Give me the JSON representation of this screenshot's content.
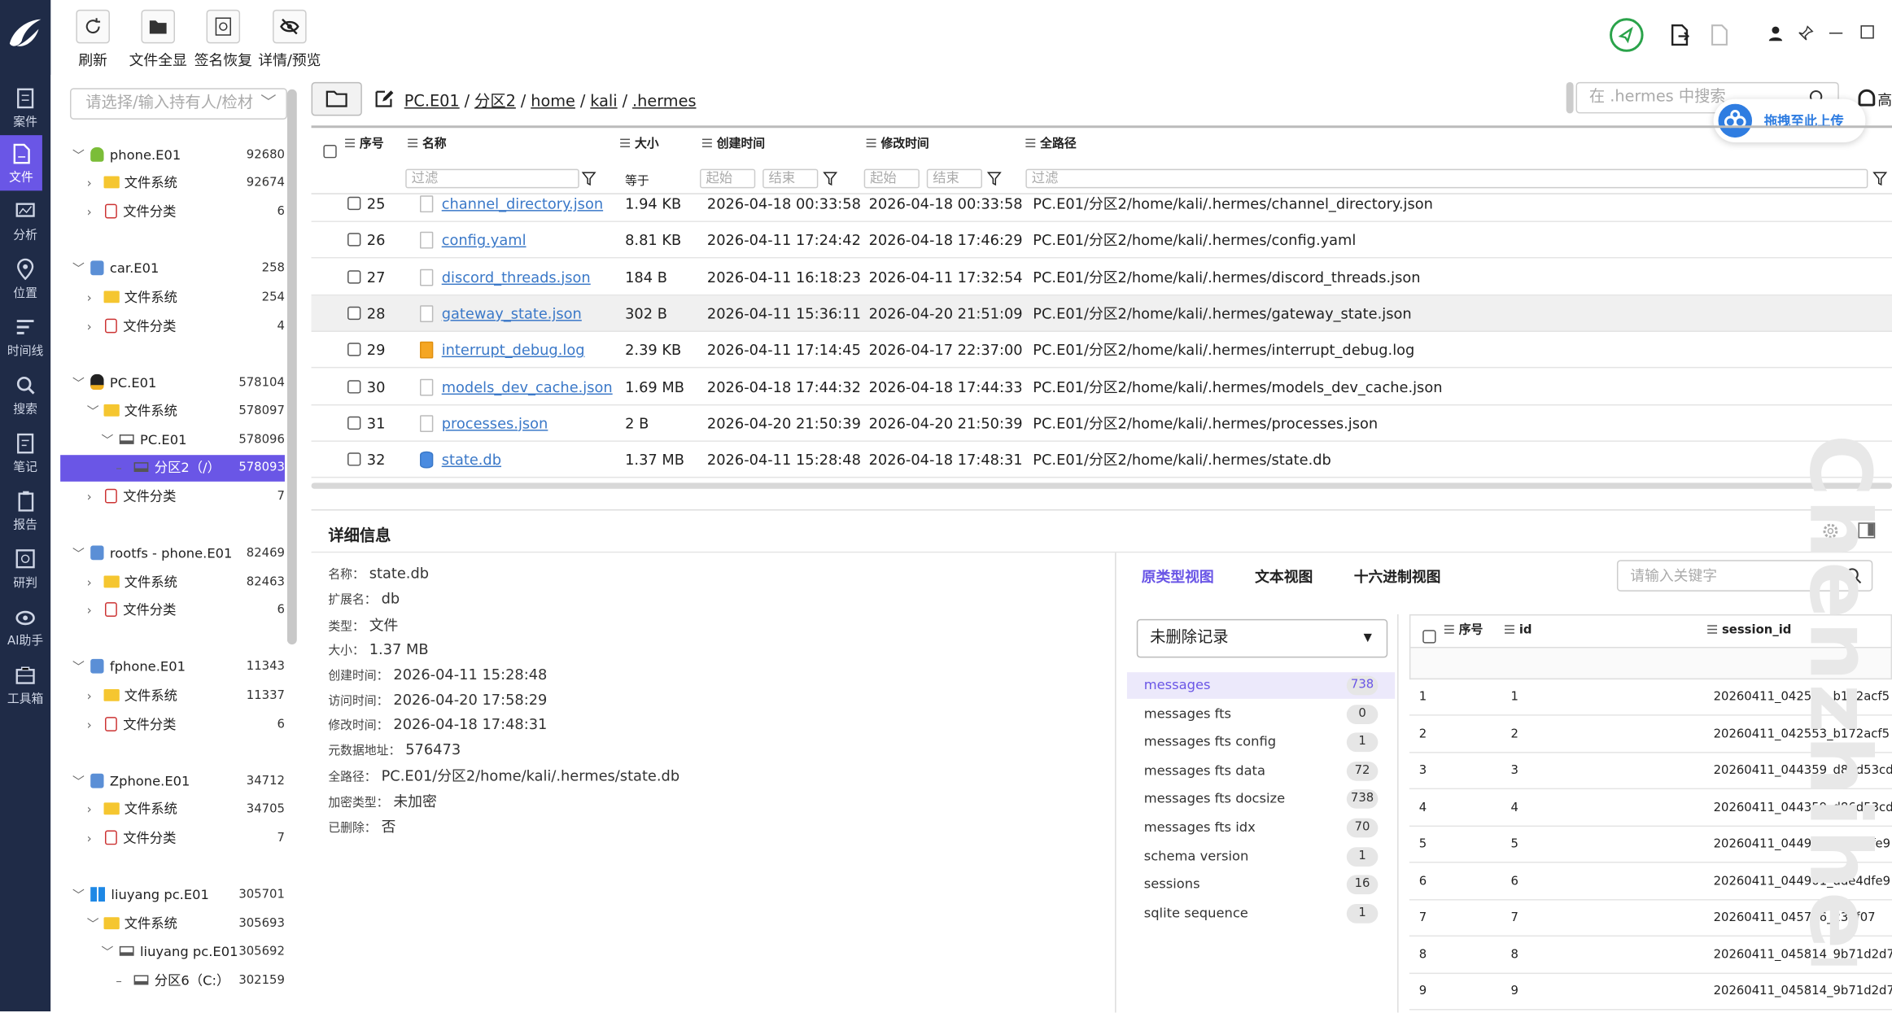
{
  "nav": {
    "items": [
      {
        "label": "案件",
        "icon": "case-icon"
      },
      {
        "label": "文件",
        "icon": "file-icon"
      },
      {
        "label": "分析",
        "icon": "analysis-icon"
      },
      {
        "label": "位置",
        "icon": "location-icon"
      },
      {
        "label": "时间线",
        "icon": "timeline-icon"
      },
      {
        "label": "搜索",
        "icon": "search-icon"
      },
      {
        "label": "笔记",
        "icon": "note-icon"
      },
      {
        "label": "报告",
        "icon": "report-icon"
      },
      {
        "label": "研判",
        "icon": "judge-icon"
      },
      {
        "label": "AI助手",
        "icon": "ai-icon"
      },
      {
        "label": "工具箱",
        "icon": "toolbox-icon"
      }
    ]
  },
  "toolbar": {
    "refresh": "刷新",
    "show_all": "文件全显",
    "sig_restore": "签名恢复",
    "detail_preview": "详情/预览"
  },
  "tree": {
    "selector_placeholder": "请选择/输入持有人/检材",
    "rows": [
      {
        "label": "phone.E01",
        "count": "92680"
      },
      {
        "label": "文件系统",
        "count": "92674"
      },
      {
        "label": "文件分类",
        "count": "6"
      },
      {
        "label": "car.E01",
        "count": "258"
      },
      {
        "label": "文件系统",
        "count": "254"
      },
      {
        "label": "文件分类",
        "count": "4"
      },
      {
        "label": "PC.E01",
        "count": "578104"
      },
      {
        "label": "文件系统",
        "count": "578097"
      },
      {
        "label": "PC.E01",
        "count": "578096"
      },
      {
        "label": "分区2（/）",
        "count": "578093"
      },
      {
        "label": "文件分类",
        "count": "7"
      },
      {
        "label": "rootfs - phone.E01",
        "count": "82469"
      },
      {
        "label": "文件系统",
        "count": "82463"
      },
      {
        "label": "文件分类",
        "count": "6"
      },
      {
        "label": "fphone.E01",
        "count": "11343"
      },
      {
        "label": "文件系统",
        "count": "11337"
      },
      {
        "label": "文件分类",
        "count": "6"
      },
      {
        "label": "Zphone.E01",
        "count": "34712"
      },
      {
        "label": "文件系统",
        "count": "34705"
      },
      {
        "label": "文件分类",
        "count": "7"
      },
      {
        "label": "liuyang pc.E01",
        "count": "305701"
      },
      {
        "label": "文件系统",
        "count": "305693"
      },
      {
        "label": "liuyang pc.E01",
        "count": "305692"
      },
      {
        "label": "分区6（C:）",
        "count": "302159"
      }
    ]
  },
  "path": {
    "segments": [
      "PC.E01",
      "分区2",
      "home",
      "kali",
      ".hermes"
    ],
    "search_placeholder": "在 .hermes 中搜索",
    "upload": "拖拽至此上传"
  },
  "grid": {
    "headers": {
      "seq": "序号",
      "name": "名称",
      "size": "大小",
      "created": "创建时间",
      "modified": "修改时间",
      "fullpath": "全路径"
    },
    "filter": {
      "placeholder": "过滤",
      "size_op": "等于",
      "start": "起始",
      "end": "结束"
    },
    "rows": [
      {
        "seq": "25",
        "name": "channel_directory.json",
        "size": "1.94 KB",
        "created": "2026-04-18 00:33:58",
        "modified": "2026-04-18 00:33:58",
        "path": "PC.E01/分区2/home/kali/.hermes/channel_directory.json",
        "type": "file"
      },
      {
        "seq": "26",
        "name": "config.yaml",
        "size": "8.81 KB",
        "created": "2026-04-11 17:24:42",
        "modified": "2026-04-18 17:46:29",
        "path": "PC.E01/分区2/home/kali/.hermes/config.yaml",
        "type": "file"
      },
      {
        "seq": "27",
        "name": "discord_threads.json",
        "size": "184 B",
        "created": "2026-04-11 16:18:23",
        "modified": "2026-04-11 17:32:54",
        "path": "PC.E01/分区2/home/kali/.hermes/discord_threads.json",
        "type": "file"
      },
      {
        "seq": "28",
        "name": "gateway_state.json",
        "size": "302 B",
        "created": "2026-04-11 15:36:11",
        "modified": "2026-04-20 21:51:09",
        "path": "PC.E01/分区2/home/kali/.hermes/gateway_state.json",
        "type": "file"
      },
      {
        "seq": "29",
        "name": "interrupt_debug.log",
        "size": "2.39 KB",
        "created": "2026-04-11 17:14:45",
        "modified": "2026-04-17 22:37:00",
        "path": "PC.E01/分区2/home/kali/.hermes/interrupt_debug.log",
        "type": "log"
      },
      {
        "seq": "30",
        "name": "models_dev_cache.json",
        "size": "1.69 MB",
        "created": "2026-04-18 17:44:32",
        "modified": "2026-04-18 17:44:33",
        "path": "PC.E01/分区2/home/kali/.hermes/models_dev_cache.json",
        "type": "file"
      },
      {
        "seq": "31",
        "name": "processes.json",
        "size": "2 B",
        "created": "2026-04-20 21:50:39",
        "modified": "2026-04-20 21:50:39",
        "path": "PC.E01/分区2/home/kali/.hermes/processes.json",
        "type": "file"
      },
      {
        "seq": "32",
        "name": "state.db",
        "size": "1.37 MB",
        "created": "2026-04-11 15:28:48",
        "modified": "2026-04-18 17:48:31",
        "path": "PC.E01/分区2/home/kali/.hermes/state.db",
        "type": "db"
      }
    ]
  },
  "details": {
    "title": "详细信息",
    "fields": [
      {
        "label": "名称：",
        "value": "state.db"
      },
      {
        "label": "扩展名：",
        "value": "db"
      },
      {
        "label": "类型：",
        "value": "文件"
      },
      {
        "label": "大小：",
        "value": "1.37 MB"
      },
      {
        "label": "创建时间：",
        "value": "2026-04-11 15:28:48"
      },
      {
        "label": "访问时间：",
        "value": "2026-04-20 17:58:29"
      },
      {
        "label": "修改时间：",
        "value": "2026-04-18 17:48:31"
      },
      {
        "label": "元数据地址：",
        "value": "576473"
      },
      {
        "label": "全路径：",
        "value": "PC.E01/分区2/home/kali/.hermes/state.db"
      },
      {
        "label": "加密类型：",
        "value": "未加密"
      },
      {
        "label": "已删除：",
        "value": "否"
      }
    ],
    "views": [
      "原类型视图",
      "文本视图",
      "十六进制视图"
    ],
    "keyword_placeholder": "请输入关键字",
    "record_filter": "未删除记录",
    "tables": [
      {
        "name": "messages",
        "count": "738"
      },
      {
        "name": "messages fts",
        "count": "0"
      },
      {
        "name": "messages fts config",
        "count": "1"
      },
      {
        "name": "messages fts data",
        "count": "72"
      },
      {
        "name": "messages fts docsize",
        "count": "738"
      },
      {
        "name": "messages fts idx",
        "count": "70"
      },
      {
        "name": "schema version",
        "count": "1"
      },
      {
        "name": "sessions",
        "count": "16"
      },
      {
        "name": "sqlite sequence",
        "count": "1"
      }
    ],
    "record_headers": {
      "seq": "序号",
      "id": "id",
      "session": "session_id"
    },
    "records": [
      {
        "seq": "1",
        "id": "1",
        "session": "20260411_042553_b172acf5"
      },
      {
        "seq": "2",
        "id": "2",
        "session": "20260411_042553_b172acf5"
      },
      {
        "seq": "3",
        "id": "3",
        "session": "20260411_044359_d86d53cd"
      },
      {
        "seq": "4",
        "id": "4",
        "session": "20260411_044359_d86d53cd"
      },
      {
        "seq": "5",
        "id": "5",
        "session": "20260411_044901_dde4dfe9"
      },
      {
        "seq": "6",
        "id": "6",
        "session": "20260411_044901_dde4dfe9"
      },
      {
        "seq": "7",
        "id": "7",
        "session": "20260411_045706_23ef07"
      },
      {
        "seq": "8",
        "id": "8",
        "session": "20260411_045814_9b71d2d7"
      },
      {
        "seq": "9",
        "id": "9",
        "session": "20260411_045814_9b71d2d7"
      }
    ]
  },
  "colors": {
    "nav_bg": "#1f2b47",
    "accent": "#6a56e6",
    "link": "#3a78c8"
  }
}
